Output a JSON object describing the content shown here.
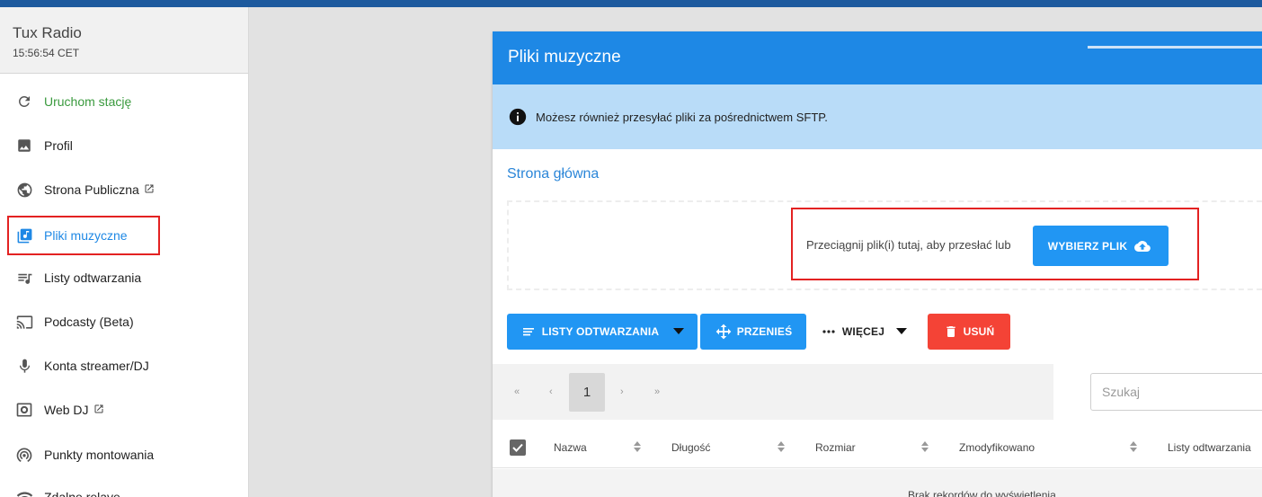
{
  "sidebar": {
    "title": "Tux Radio",
    "time": "15:56:54 CET",
    "items": [
      {
        "label": "Uruchom stację",
        "icon": "restart-icon"
      },
      {
        "label": "Profil",
        "icon": "image-icon"
      },
      {
        "label": "Strona Publiczna",
        "icon": "globe-icon",
        "external": true
      },
      {
        "label": "Pliki muzyczne",
        "icon": "music-library-icon",
        "active": true
      },
      {
        "label": "Listy odtwarzania",
        "icon": "playlist-icon"
      },
      {
        "label": "Podcasty (Beta)",
        "icon": "cast-icon"
      },
      {
        "label": "Konta streamer/DJ",
        "icon": "microphone-icon"
      },
      {
        "label": "Web DJ",
        "icon": "speaker-icon",
        "external": true
      },
      {
        "label": "Punkty montowania",
        "icon": "broadcast-icon"
      },
      {
        "label": "Zdalne relaye",
        "icon": "wifi-icon"
      }
    ]
  },
  "main": {
    "title": "Pliki muzyczne",
    "info": "Możesz również przesyłać pliki za pośrednictwem SFTP.",
    "breadcrumb": "Strona główna",
    "drop_text": "Przeciągnij plik(i) tutaj, aby przesłać lub",
    "choose_label": "WYBIERZ PLIK",
    "toolbar": {
      "playlists_label": "LISTY ODTWARZANIA",
      "move_label": "PRZENIEŚ",
      "more_label": "WIĘCEJ",
      "delete_label": "USUŃ"
    },
    "pager": {
      "first": "«",
      "prev": "‹",
      "current": "1",
      "next": "›",
      "last": "»"
    },
    "search": {
      "placeholder": "Szukaj"
    },
    "table": {
      "columns": [
        "Nazwa",
        "Długość",
        "Rozmiar",
        "Zmodyfikowano",
        "Listy odtwarzania"
      ],
      "empty": "Brak rekordów do wyświetlenia"
    }
  },
  "colors": {
    "accent": "#1e88e5",
    "active_nav": "#1e88e5",
    "restart_green": "#3a9a3e",
    "delete_red": "#f44336",
    "highlight_red": "#e32222",
    "info_bg": "#b9dcf8"
  }
}
